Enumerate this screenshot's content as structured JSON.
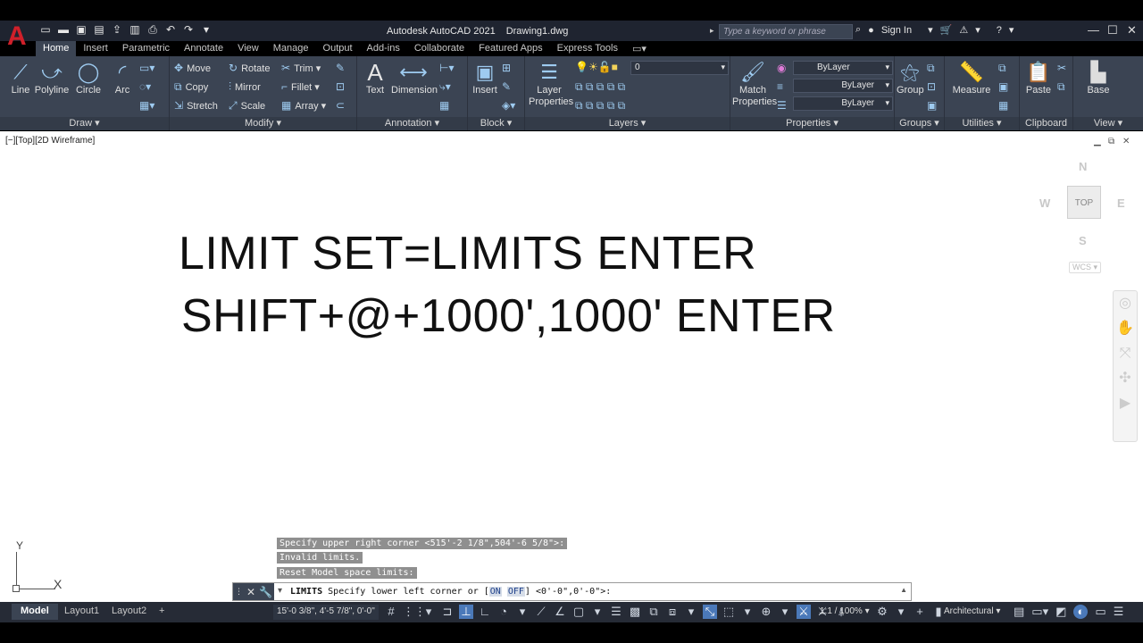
{
  "window": {
    "app_title": "Autodesk AutoCAD 2021",
    "file_name": "Drawing1.dwg",
    "search_placeholder": "Type a keyword or phrase",
    "sign_in": "Sign In"
  },
  "tabs": [
    "Home",
    "Insert",
    "Parametric",
    "Annotate",
    "View",
    "Manage",
    "Output",
    "Add-ins",
    "Collaborate",
    "Featured Apps",
    "Express Tools"
  ],
  "ribbon": {
    "draw": {
      "title": "Draw",
      "line": "Line",
      "polyline": "Polyline",
      "circle": "Circle",
      "arc": "Arc"
    },
    "modify": {
      "title": "Modify",
      "move": "Move",
      "rotate": "Rotate",
      "trim": "Trim",
      "copy": "Copy",
      "mirror": "Mirror",
      "fillet": "Fillet",
      "stretch": "Stretch",
      "scale": "Scale",
      "array": "Array"
    },
    "annotation": {
      "title": "Annotation",
      "text": "Text",
      "dimension": "Dimension"
    },
    "block": {
      "title": "Block",
      "insert": "Insert"
    },
    "layers": {
      "title": "Layers",
      "layer_properties": "Layer Properties",
      "current_layer": "0"
    },
    "properties": {
      "title": "Properties",
      "match_properties": "Match Properties",
      "color": "ByLayer",
      "linetype": "ByLayer",
      "lineweight": "ByLayer"
    },
    "groups": {
      "title": "Groups",
      "group": "Group"
    },
    "utilities": {
      "title": "Utilities",
      "measure": "Measure"
    },
    "clipboard": {
      "title": "Clipboard",
      "paste": "Paste"
    },
    "view": {
      "title": "View",
      "base": "Base"
    }
  },
  "viewport": {
    "label": "[−][Top][2D Wireframe]",
    "text_line1": "LIMIT SET=LIMITS ENTER",
    "text_line2": "SHIFT+@+1000',1000' ENTER",
    "viewcube": {
      "n": "N",
      "s": "S",
      "e": "E",
      "w": "W",
      "face": "TOP",
      "wcs": "WCS"
    },
    "ucs": {
      "x": "X",
      "y": "Y"
    }
  },
  "command": {
    "history": [
      "Specify upper right corner <515'-2 1/8\",504'-6 5/8\">:",
      "Invalid limits.",
      "Reset Model space limits:"
    ],
    "name": "LIMITS",
    "prompt": "Specify lower left corner or [",
    "opt_on": "ON",
    "opt_off": "OFF",
    "suffix": "] <0'-0\",0'-0\">:"
  },
  "status": {
    "tabs": [
      "Model",
      "Layout1",
      "Layout2"
    ],
    "add_tab": "+",
    "coords": "15'-0 3/8\", 4'-5 7/8\", 0'-0\"",
    "scale": "1:1 / 100%",
    "units": "Architectural"
  },
  "colors": {
    "brand_red": "#d0202a",
    "ribbon_bg": "#3b4453",
    "titlebar_bg": "#1f2430",
    "status_bg": "#262b36"
  }
}
